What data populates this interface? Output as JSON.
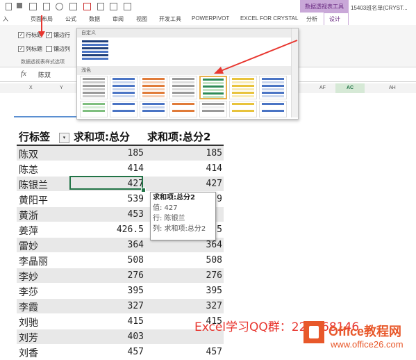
{
  "ribbon": {
    "context_group": "数据透视表工具",
    "document_name": "15403班名单(CRYST...",
    "tabs": [
      "入",
      "页面布局",
      "公式",
      "数据",
      "审阅",
      "视图",
      "开发工具",
      "POWERPIVOT",
      "EXCEL FOR CRYSTAL",
      "分析",
      "设计"
    ],
    "active_tab": "设计",
    "options": {
      "row_headers": "行标题",
      "col_headers": "列标题",
      "banded_rows": "镶边行",
      "banded_cols": "镶边列",
      "group_label": "数据透视表样式选项"
    }
  },
  "formula_bar": {
    "fx": "fx",
    "value": "陈双"
  },
  "column_headers": {
    "x": "X",
    "y": "Y",
    "af": "AF",
    "ac": "AC",
    "ah": "AH"
  },
  "gallery": {
    "custom_label": "自定义",
    "light_label": "浅色"
  },
  "pivot": {
    "header": {
      "row_label": "行标签",
      "filter": "▾",
      "col1": "求和项:总分",
      "col2": "求和项:总分2"
    },
    "rows": [
      {
        "name": "陈双",
        "v1": "185",
        "v2": "185"
      },
      {
        "name": "陈恙",
        "v1": "414",
        "v2": "414"
      },
      {
        "name": "陈银兰",
        "v1": "427",
        "v2": "427"
      },
      {
        "name": "黄阳平",
        "v1": "539",
        "v2": "9"
      },
      {
        "name": "黄浙",
        "v1": "453",
        "v2": ""
      },
      {
        "name": "姜萍",
        "v1": "426.5",
        "v2": "5"
      },
      {
        "name": "雷妙",
        "v1": "364",
        "v2": "364"
      },
      {
        "name": "李晶丽",
        "v1": "508",
        "v2": "508"
      },
      {
        "name": "李妙",
        "v1": "276",
        "v2": "276"
      },
      {
        "name": "李莎",
        "v1": "395",
        "v2": "395"
      },
      {
        "name": "李霞",
        "v1": "327",
        "v2": "327"
      },
      {
        "name": "刘驰",
        "v1": "415",
        "v2": "415"
      },
      {
        "name": "刘芳",
        "v1": "403",
        "v2": ""
      },
      {
        "name": "刘香",
        "v1": "457",
        "v2": "457"
      }
    ]
  },
  "tooltip": {
    "title": "求和项:总分2",
    "value": "值: 427",
    "row": "行: 陈银兰",
    "col": "列: 求和项:总分2"
  },
  "watermark": {
    "qq": "Excel学习QQ群：221768146",
    "brand": "Office教程网",
    "url": "www.office26.com"
  },
  "colors": {
    "accent": "#217346",
    "context": "#c9a8d8",
    "arrow": "#e8362f",
    "brand": "#e8582a"
  }
}
